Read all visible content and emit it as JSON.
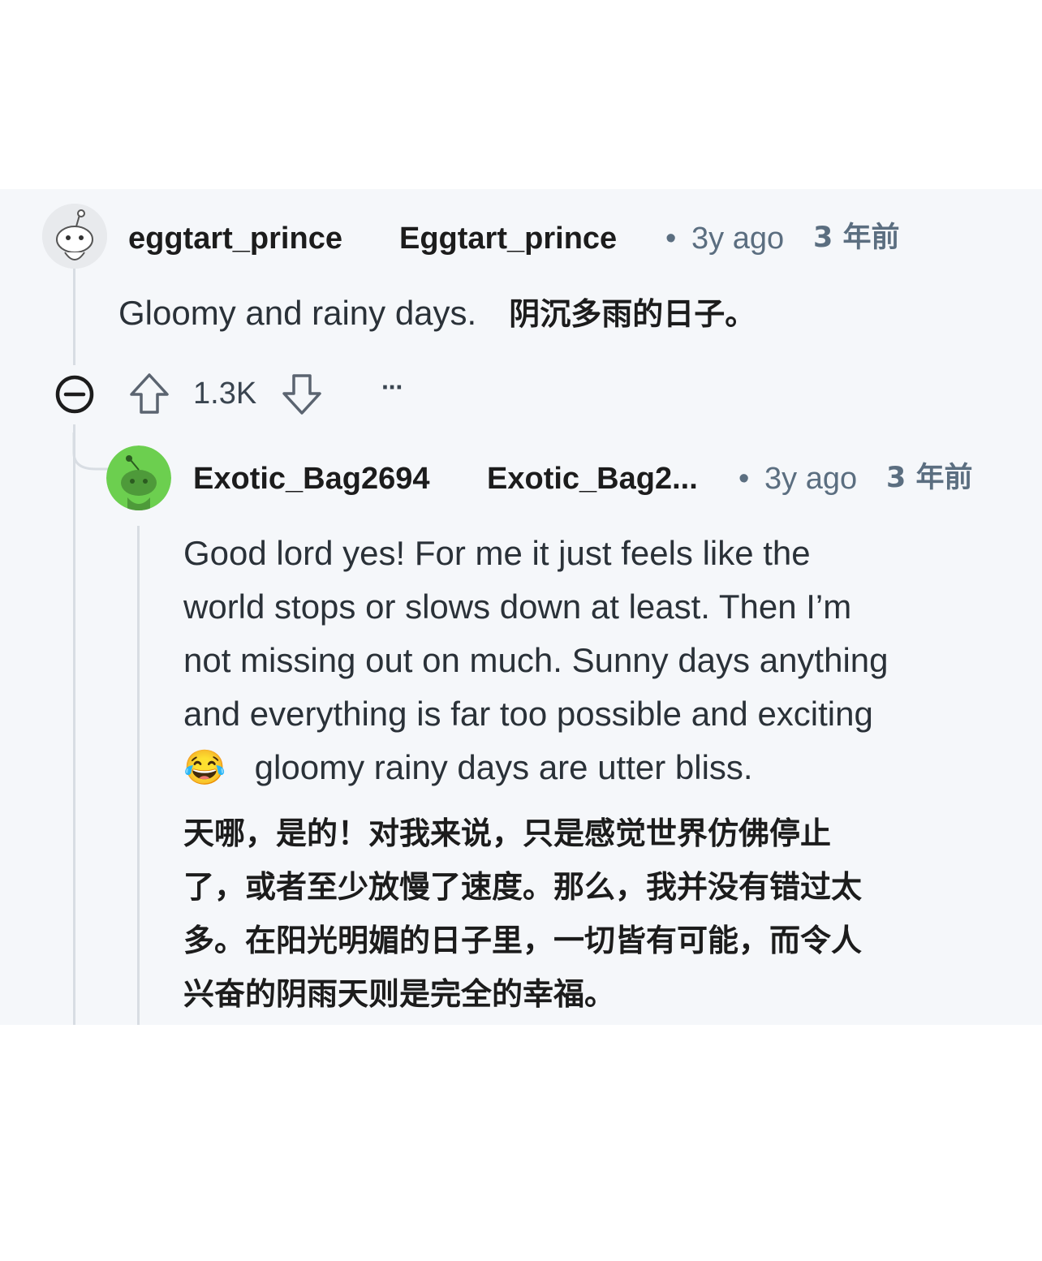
{
  "comment": {
    "username": "eggtart_prince",
    "display_name": "Eggtart_prince",
    "separator": "•",
    "time": "3y ago",
    "time_cn": "3 年前",
    "body": "Gloomy and rainy days.",
    "body_cn": "阴沉多雨的日子。",
    "score": "1.3K",
    "collapse_icon": "collapse-minus-icon",
    "upvote_icon": "upvote-arrow-icon",
    "downvote_icon": "downvote-arrow-icon",
    "more_label": "···"
  },
  "reply": {
    "username": "Exotic_Bag2694",
    "display_name": "Exotic_Bag2...",
    "separator": "•",
    "time": "3y ago",
    "time_cn": "3 年前",
    "body_lines": [
      "Good lord yes! For me it just feels like the",
      "world stops or slows down at least. Then I’m",
      "not missing out on much. Sunny days anything",
      "and everything is far too possible and exciting"
    ],
    "body_last_line": "gloomy rainy days are utter bliss.",
    "emoji": "😂",
    "body_cn_lines": [
      "天哪，是的！对我来说，只是感觉世界仿佛停止",
      "了，或者至少放慢了速度。那么，我并没有错过太",
      "多。在阳光明媚的日子里，一切皆有可能，而令人",
      "兴奋的阴雨天则是完全的幸福。"
    ],
    "avatar_color": "#6ccf4f"
  }
}
